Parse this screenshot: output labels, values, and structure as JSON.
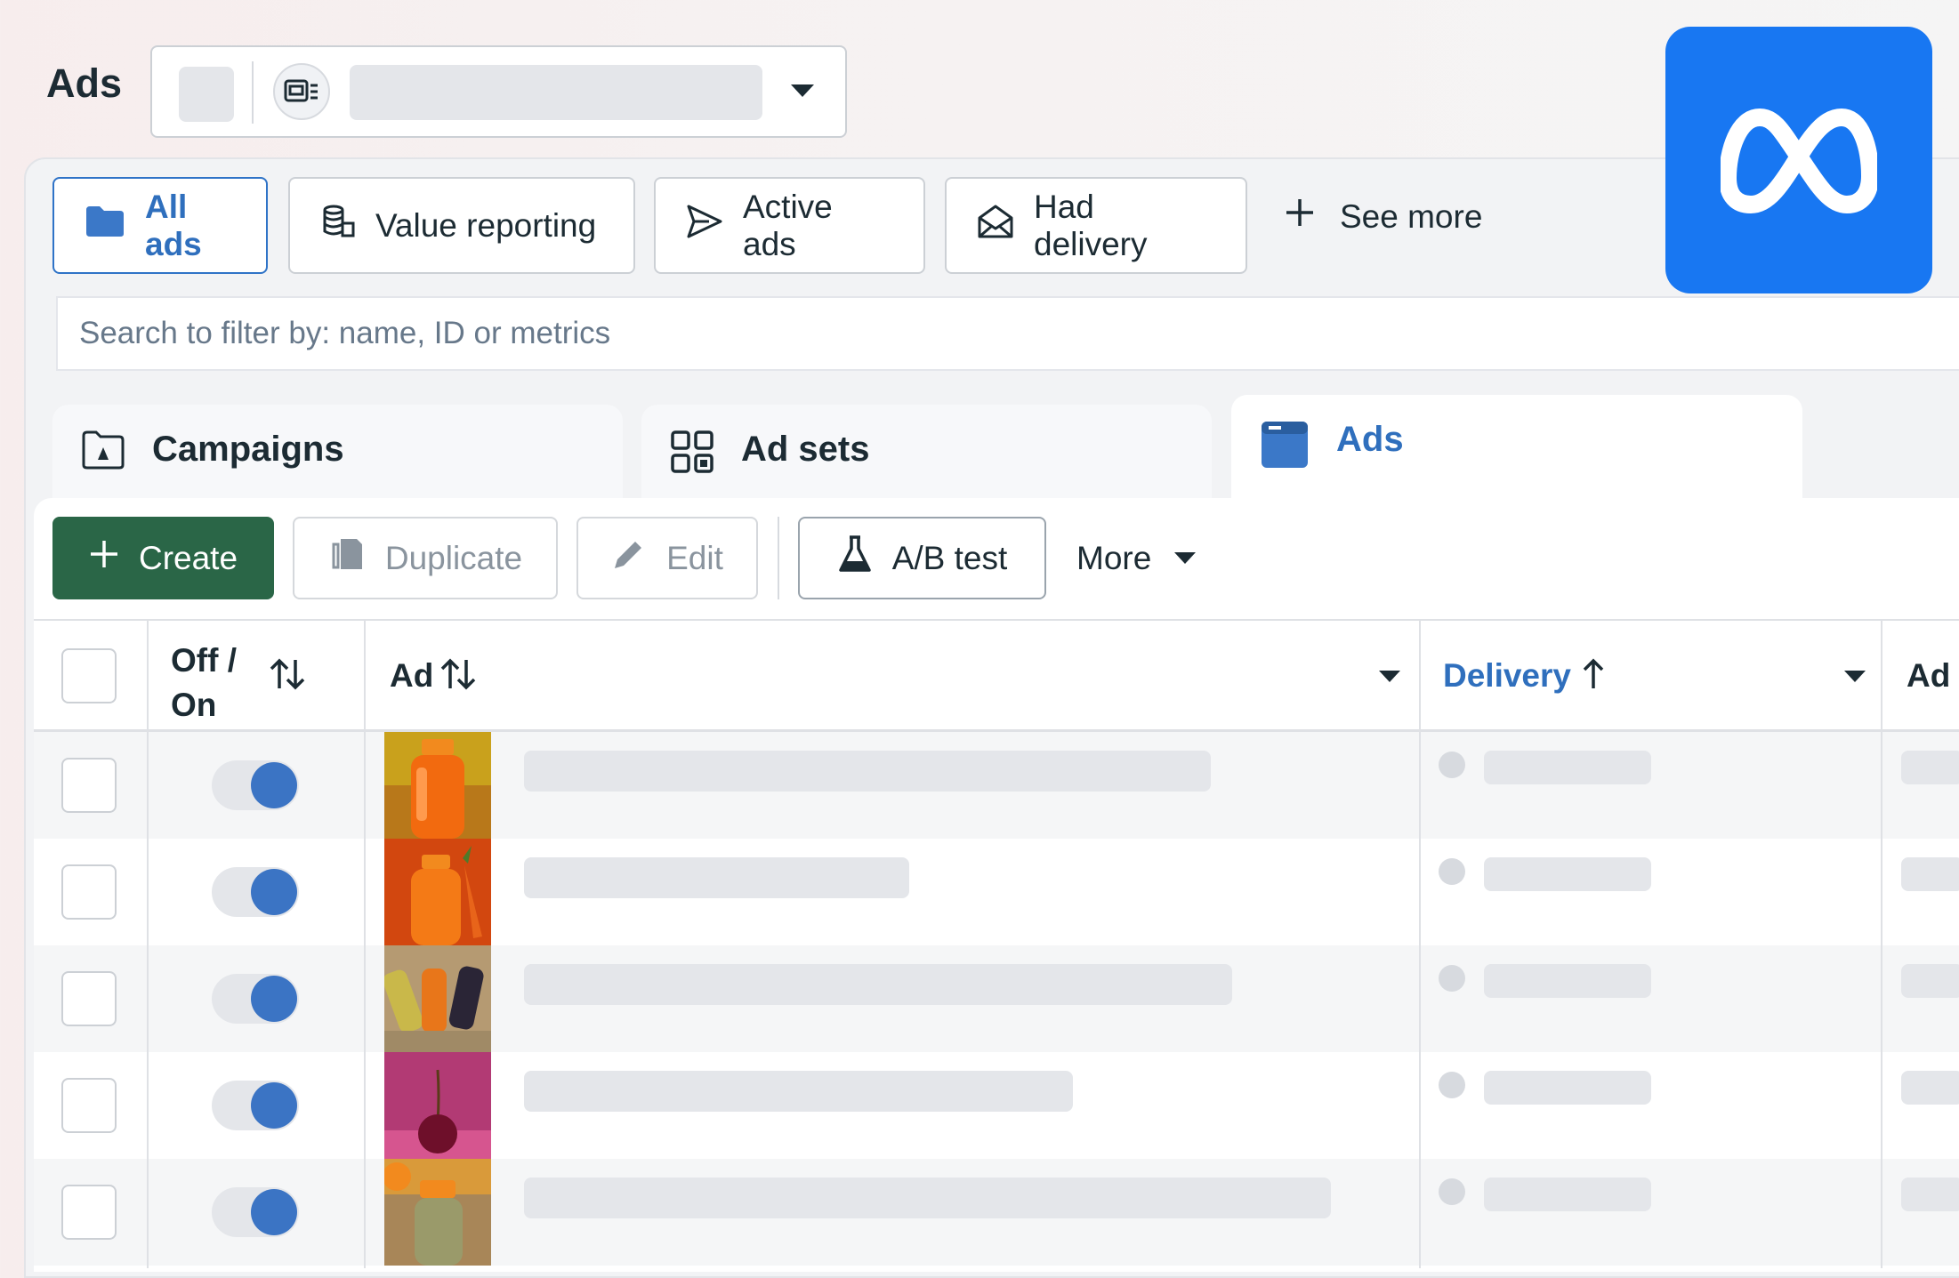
{
  "header": {
    "title": "Ads",
    "account_selector_icon": "ad-account-icon"
  },
  "filter_tabs": [
    {
      "label": "All ads",
      "icon": "folder-icon",
      "active": true
    },
    {
      "label": "Value reporting",
      "icon": "coins-icon",
      "active": false
    },
    {
      "label": "Active ads",
      "icon": "send-icon",
      "active": false
    },
    {
      "label": "Had delivery",
      "icon": "envelope-open-icon",
      "active": false
    }
  ],
  "see_more_label": "See more",
  "search": {
    "placeholder": "Search to filter by: name, ID or metrics"
  },
  "level_tabs": [
    {
      "label": "Campaigns",
      "icon": "campaign-folder-icon"
    },
    {
      "label": "Ad sets",
      "icon": "grid-icon"
    },
    {
      "label": "Ads",
      "icon": "ad-window-icon",
      "active": true
    }
  ],
  "toolbar": {
    "create": "Create",
    "duplicate": "Duplicate",
    "edit": "Edit",
    "ab_test": "A/B test",
    "more": "More"
  },
  "table": {
    "columns": {
      "off_on": "Off / On",
      "ad": "Ad",
      "delivery": "Delivery",
      "next": "Ad s"
    },
    "rows": [
      {
        "enabled": true,
        "thumbnail": "orange juice bottle",
        "grey": true
      },
      {
        "enabled": true,
        "thumbnail": "orange bottle with carrot",
        "grey": false
      },
      {
        "enabled": true,
        "thumbnail": "three juice bottles",
        "grey": true
      },
      {
        "enabled": true,
        "thumbnail": "cherry on pink",
        "grey": false
      },
      {
        "enabled": true,
        "thumbnail": "bottle in net bag",
        "grey": true
      }
    ]
  },
  "colors": {
    "accent_blue": "#2f6fbd",
    "create_green": "#2a6647",
    "meta_blue": "#1877f2"
  },
  "logo": {
    "name": "meta-logo"
  }
}
